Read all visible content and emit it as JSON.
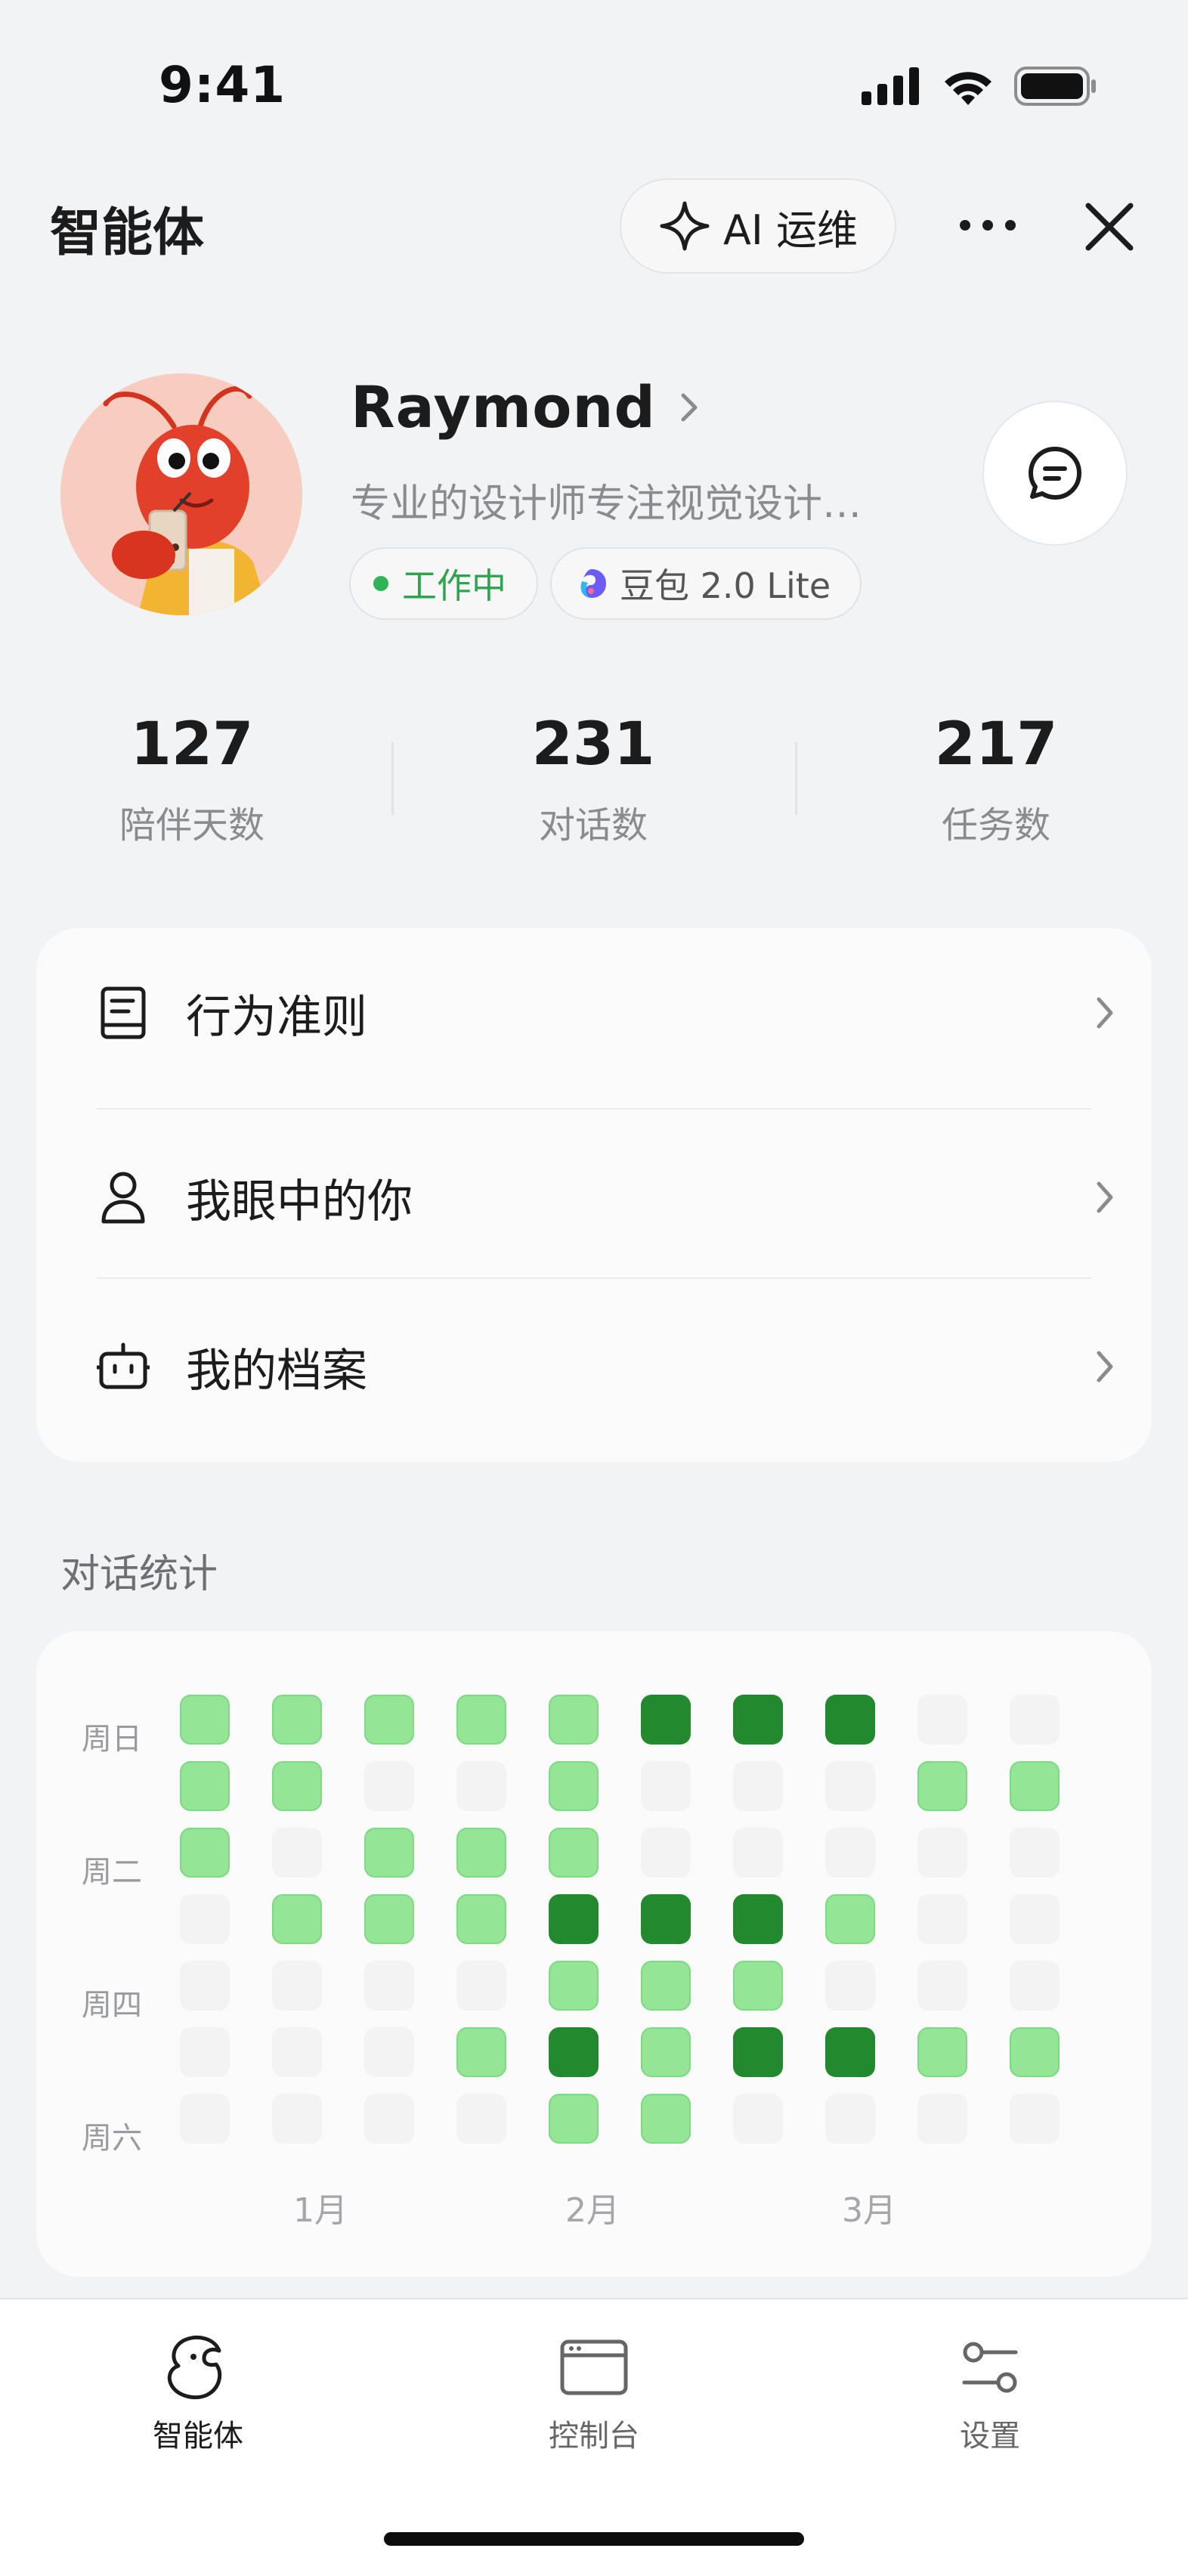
{
  "status_bar": {
    "time": "9:41"
  },
  "header": {
    "title": "智能体",
    "ai_button_label": "AI 运维"
  },
  "profile": {
    "name": "Raymond",
    "bio": "专业的设计师专注视觉设计…",
    "status_tag": "工作中",
    "model_tag": "豆包 2.0 Lite"
  },
  "stats": [
    {
      "value": "127",
      "label": "陪伴天数"
    },
    {
      "value": "231",
      "label": "对话数"
    },
    {
      "value": "217",
      "label": "任务数"
    }
  ],
  "menu": [
    {
      "label": "行为准则",
      "icon": "book-icon"
    },
    {
      "label": "我眼中的你",
      "icon": "user-icon"
    },
    {
      "label": "我的档案",
      "icon": "robot-icon"
    }
  ],
  "activity": {
    "title": "对话统计",
    "day_labels": [
      "周日",
      "周二",
      "周四",
      "周六"
    ],
    "month_labels": [
      "1月",
      "2月",
      "3月"
    ],
    "legend_levels": [
      "empty",
      "light",
      "dark"
    ],
    "colors": {
      "empty": "#f3f3f4",
      "light": "#94e596",
      "dark": "#23892e"
    },
    "grid": [
      [
        1,
        1,
        1,
        1,
        1,
        2,
        2,
        2,
        0,
        0
      ],
      [
        1,
        1,
        0,
        0,
        1,
        0,
        0,
        0,
        1,
        1
      ],
      [
        1,
        0,
        1,
        1,
        1,
        0,
        0,
        0,
        0,
        0
      ],
      [
        0,
        1,
        1,
        1,
        2,
        2,
        2,
        1,
        0,
        0
      ],
      [
        0,
        0,
        0,
        0,
        1,
        1,
        1,
        0,
        0,
        0
      ],
      [
        0,
        0,
        0,
        1,
        2,
        1,
        2,
        2,
        1,
        1
      ],
      [
        0,
        0,
        0,
        0,
        1,
        1,
        0,
        0,
        0,
        0
      ]
    ]
  },
  "tabbar": {
    "tabs": [
      {
        "label": "智能体",
        "icon": "agent-icon",
        "active": true
      },
      {
        "label": "控制台",
        "icon": "console-icon",
        "active": false
      },
      {
        "label": "设置",
        "icon": "settings-icon",
        "active": false
      }
    ]
  },
  "theme": {
    "accent_green": "#2da44e",
    "background": "#f2f3f5"
  }
}
